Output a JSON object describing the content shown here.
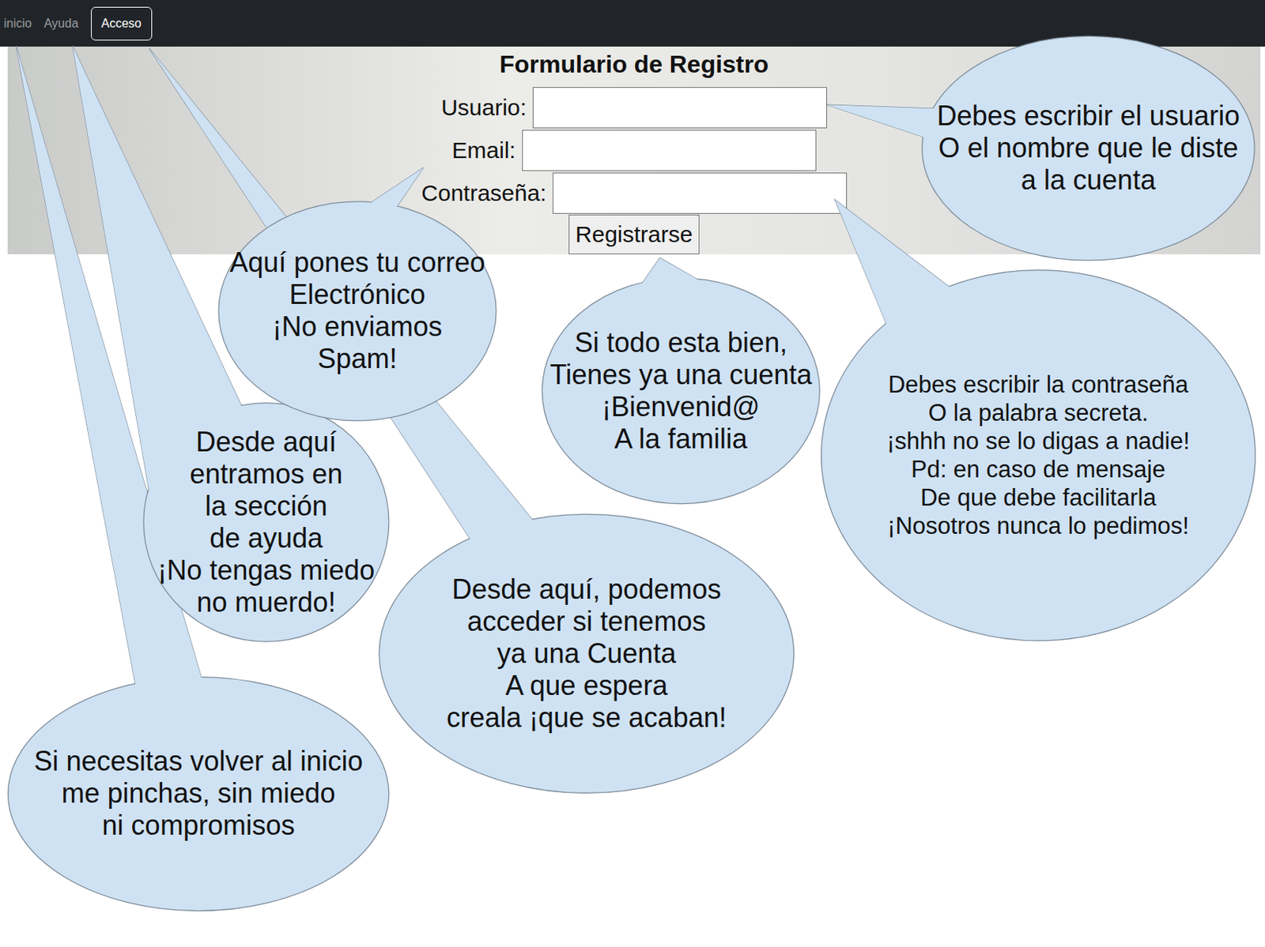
{
  "nav": [
    {
      "label": "inicio",
      "kind": "link"
    },
    {
      "label": "Ayuda",
      "kind": "link"
    },
    {
      "label": "Acceso",
      "kind": "button"
    }
  ],
  "form": {
    "title": "Formulario de Registro",
    "fields": [
      {
        "label": "Usuario:",
        "value": ""
      },
      {
        "label": "Email:",
        "value": ""
      },
      {
        "label": "Contraseña:",
        "value": ""
      }
    ],
    "submit": "Registrarse"
  },
  "callouts": [
    {
      "lines": [
        "Si necesitas volver al inicio",
        "me pinchas, sin miedo",
        "ni compromisos"
      ]
    },
    {
      "lines": [
        "Desde aquí",
        "entramos en",
        "la sección",
        "de ayuda",
        "¡No tengas miedo",
        "no muerdo!"
      ]
    },
    {
      "lines": [
        "Desde aquí, podemos",
        "acceder si tenemos",
        "ya una Cuenta",
        "A que espera",
        "creala ¡que se acaban!"
      ]
    },
    {
      "lines": [
        "Aquí pones tu correo",
        "Electrónico",
        "¡No enviamos",
        "Spam!"
      ]
    },
    {
      "lines": [
        "Si todo esta bien,",
        "Tienes ya una cuenta",
        "¡Bienvenid@",
        "A la familia"
      ]
    },
    {
      "lines": [
        "Debes escribir la contraseña",
        "O la palabra secreta.",
        "¡shhh no se lo digas a nadie!",
        "Pd: en caso de mensaje",
        "De que debe facilitarla",
        "¡Nosotros nunca lo pedimos!"
      ]
    },
    {
      "lines": [
        "Debes escribir el usuario",
        "O el nombre que le diste",
        "a la cuenta"
      ]
    }
  ]
}
